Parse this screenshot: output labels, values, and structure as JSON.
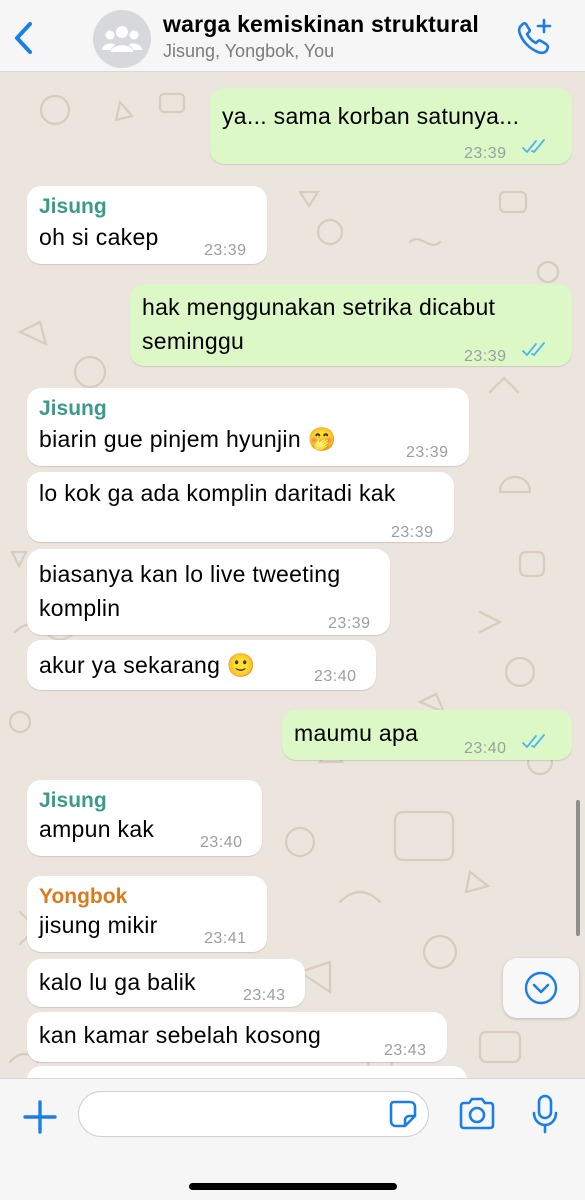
{
  "header": {
    "title": "warga kemiskinan struktural",
    "subtitle": "Jisung, Yongbok, You",
    "back_icon": "chevron-left-icon",
    "avatar_icon": "group-icon",
    "call_icon": "phone-plus-icon"
  },
  "colors": {
    "accent": "#1a7ee8",
    "outgoing_bubble": "#dcf8c6",
    "incoming_bubble": "#ffffff",
    "jisung_name": "#3a9a8c",
    "yongbok_name": "#d97a1c",
    "read_ticks": "#4fb6ec",
    "wallpaper": "#ece5dd"
  },
  "messages": [
    {
      "direction": "out",
      "text": "ya... sama korban satunya...",
      "time": "23:39",
      "read": true
    },
    {
      "direction": "in",
      "sender": "Jisung",
      "text": "oh si cakep",
      "time": "23:39"
    },
    {
      "direction": "out",
      "lines": [
        "hak menggunakan setrika dicabut",
        "seminggu"
      ],
      "time": "23:39",
      "read": true
    },
    {
      "direction": "in",
      "sender": "Jisung",
      "text": "biarin gue pinjem hyunjin 🤭",
      "time": "23:39"
    },
    {
      "direction": "in",
      "text": "lo kok ga ada komplin daritadi kak",
      "time": "23:39"
    },
    {
      "direction": "in",
      "lines": [
        "biasanya kan lo live tweeting",
        "komplin"
      ],
      "time": "23:39"
    },
    {
      "direction": "in",
      "text": "akur ya sekarang 🙂",
      "time": "23:40"
    },
    {
      "direction": "out",
      "text": "maumu apa",
      "time": "23:40",
      "read": true
    },
    {
      "direction": "in",
      "sender": "Jisung",
      "text": "ampun kak",
      "time": "23:40"
    },
    {
      "direction": "in",
      "sender": "Yongbok",
      "text": "jisung mikir",
      "time": "23:41"
    },
    {
      "direction": "in",
      "text": "kalo lu ga balik",
      "time": "23:43"
    },
    {
      "direction": "in",
      "text": "kan kamar sebelah kosong",
      "time": "23:43"
    }
  ],
  "scroll_to_bottom_icon": "chevron-down-circle-icon",
  "input": {
    "value": "",
    "placeholder": "",
    "plus_icon": "plus-icon",
    "sticker_icon": "sticker-icon",
    "camera_icon": "camera-icon",
    "mic_icon": "microphone-icon"
  }
}
